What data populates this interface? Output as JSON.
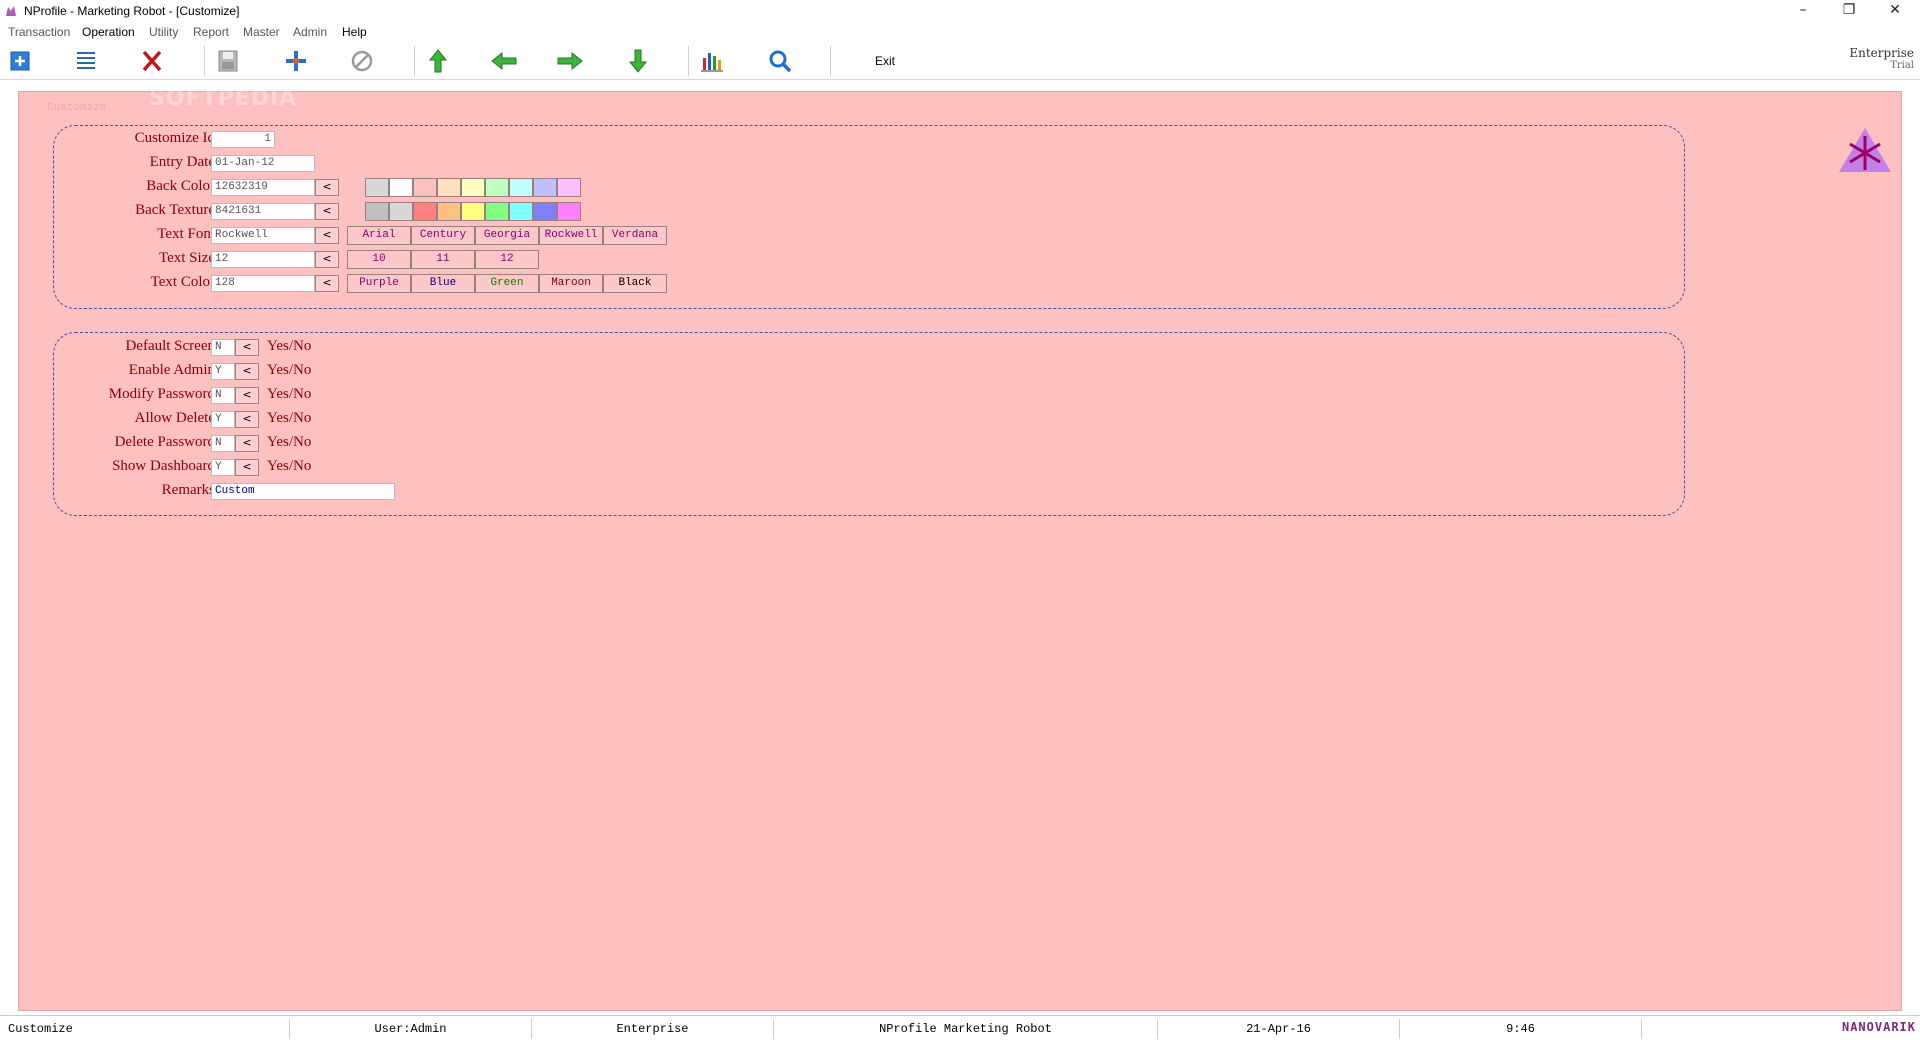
{
  "window": {
    "title": "NProfile - Marketing Robot - [Customize]",
    "minimize": "–",
    "restore": "❐",
    "close": "✕"
  },
  "menu": [
    "Transaction",
    "Operation",
    "Utility",
    "Report",
    "Master",
    "Admin",
    "Help"
  ],
  "toolbar": {
    "exit_label": "Exit",
    "edition": "Enterprise",
    "edition_sub": "Trial"
  },
  "panel": {
    "caption": "Customize",
    "watermark": "SOFTPEDIA"
  },
  "form": {
    "customize_id": {
      "label": "Customize Id",
      "value": "1"
    },
    "entry_date": {
      "label": "Entry Date",
      "value": "01-Jan-12"
    },
    "back_color": {
      "label": "Back Color",
      "value": "12632319"
    },
    "back_texture": {
      "label": "Back Texture",
      "value": "8421631"
    },
    "text_font": {
      "label": "Text Font",
      "value": "Rockwell"
    },
    "text_size": {
      "label": "Text Size",
      "value": "12"
    },
    "text_color": {
      "label": "Text Color",
      "value": "128"
    },
    "pick_label": "<"
  },
  "back_color_swatches": [
    "#d8d8d8",
    "#ffffff",
    "#ffc0c0",
    "#ffe0c0",
    "#ffffc0",
    "#c0ffc0",
    "#c0ffff",
    "#c0c0ff",
    "#ffc0ff"
  ],
  "back_texture_swatches": [
    "#c0c0c0",
    "#d8d8d8",
    "#ff8080",
    "#ffc080",
    "#ffff80",
    "#80ff80",
    "#80ffff",
    "#8080ff",
    "#ff80ff"
  ],
  "font_options": [
    "Arial",
    "Century",
    "Georgia",
    "Rockwell",
    "Verdana"
  ],
  "size_options": [
    "10",
    "11",
    "12"
  ],
  "color_options": [
    {
      "label": "Purple",
      "color": "#800080"
    },
    {
      "label": "Blue",
      "color": "#000080"
    },
    {
      "label": "Green",
      "color": "#008000"
    },
    {
      "label": "Maroon",
      "color": "#800000"
    },
    {
      "label": "Black",
      "color": "#000000"
    }
  ],
  "settings": {
    "default_screen": {
      "label": "Default Screen",
      "value": "N"
    },
    "enable_admin": {
      "label": "Enable Admin",
      "value": "Y"
    },
    "modify_password": {
      "label": "Modify Password",
      "value": "N"
    },
    "allow_delete": {
      "label": "Allow Delete",
      "value": "Y"
    },
    "delete_password": {
      "label": "Delete Password",
      "value": "N"
    },
    "show_dashboard": {
      "label": "Show Dashboard",
      "value": "Y"
    },
    "remarks": {
      "label": "Remarks",
      "value": "Custom"
    },
    "yes_no": "Yes/No"
  },
  "status": {
    "screen": "Customize",
    "user": "User:Admin",
    "edition": "Enterprise",
    "product": "NProfile Marketing Robot",
    "date": "21-Apr-16",
    "time": "9:46",
    "brand": "NANOVARIK"
  },
  "colors": {
    "panel_bg": "#ffc0c0",
    "label": "#8b0000",
    "group_border": "#4d4d9a"
  }
}
